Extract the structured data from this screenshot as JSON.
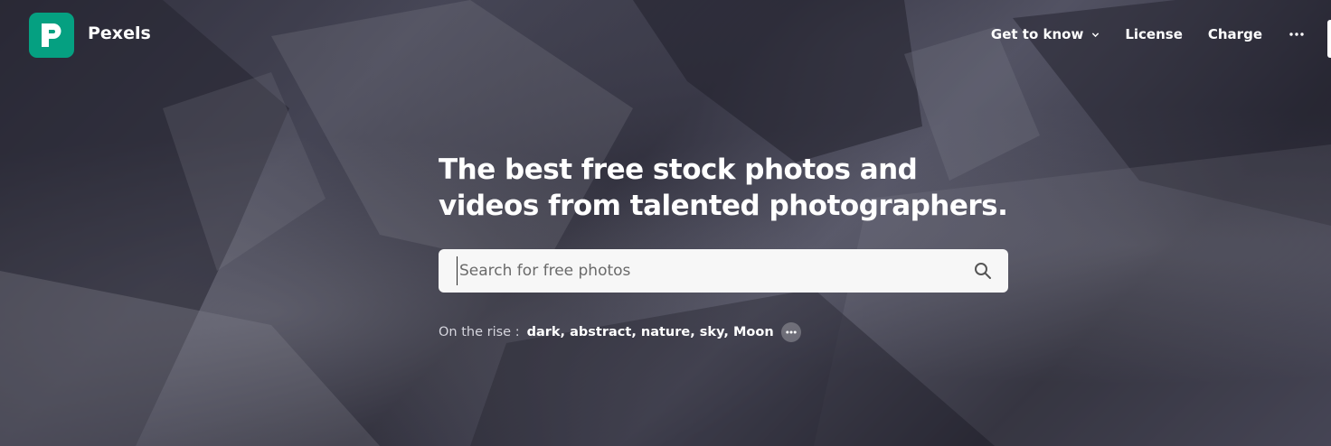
{
  "brand": {
    "name": "Pexels",
    "accent": "#05a081",
    "logo_icon": "pexels-logo-icon"
  },
  "nav": {
    "items": [
      {
        "label": "Get to know",
        "has_dropdown": true
      },
      {
        "label": "License"
      },
      {
        "label": "Charge"
      }
    ],
    "more_icon": "more-dots-icon"
  },
  "hero": {
    "headline": "The best free stock photos and videos from talented photographers.",
    "search": {
      "placeholder": "Search for free photos",
      "value": "",
      "icon": "search-icon"
    },
    "trending": {
      "label": "On the rise :",
      "terms": [
        "dark",
        "abstract",
        "nature",
        "sky",
        "Moon"
      ],
      "more_icon": "more-dots-icon"
    }
  }
}
